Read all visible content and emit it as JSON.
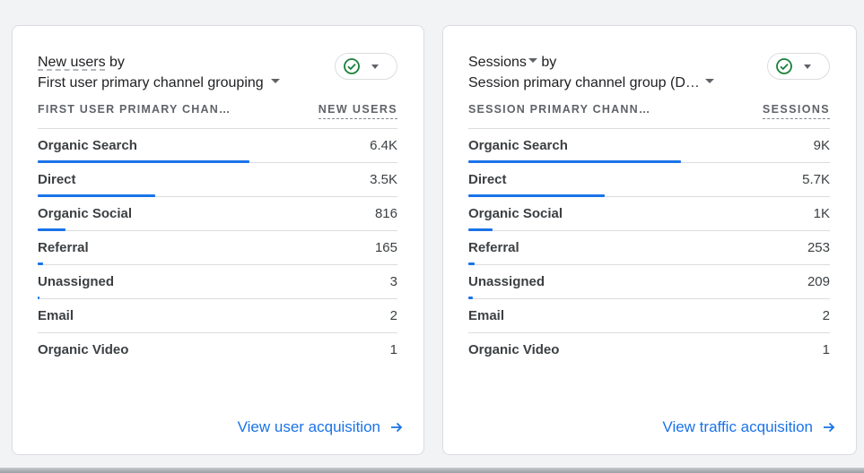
{
  "cards": [
    {
      "metric": "New users",
      "by": "by",
      "dimension": "First user primary channel grouping",
      "col_label": "FIRST USER PRIMARY CHANNEL GROUP",
      "col_value": "NEW USERS",
      "link": "View user acquisition",
      "rows": [
        {
          "label": "Organic Search",
          "value": "6.4K",
          "fraction": 1.0
        },
        {
          "label": "Direct",
          "value": "3.5K",
          "fraction": 0.555
        },
        {
          "label": "Organic Social",
          "value": "816",
          "fraction": 0.13
        },
        {
          "label": "Referral",
          "value": "165",
          "fraction": 0.026
        },
        {
          "label": "Unassigned",
          "value": "3",
          "fraction": 0.005
        },
        {
          "label": "Email",
          "value": "2",
          "fraction": 0
        },
        {
          "label": "Organic Video",
          "value": "1",
          "fraction": 0
        }
      ]
    },
    {
      "metric": "Sessions",
      "by": "by",
      "dimension": "Session primary channel group (Default Channel Group)",
      "col_label": "SESSION PRIMARY CHANNEL GROUP",
      "col_value": "SESSIONS",
      "link": "View traffic acquisition",
      "rows": [
        {
          "label": "Organic Search",
          "value": "9K",
          "fraction": 1.0
        },
        {
          "label": "Direct",
          "value": "5.7K",
          "fraction": 0.64
        },
        {
          "label": "Organic Social",
          "value": "1K",
          "fraction": 0.115
        },
        {
          "label": "Referral",
          "value": "253",
          "fraction": 0.028
        },
        {
          "label": "Unassigned",
          "value": "209",
          "fraction": 0.023
        },
        {
          "label": "Email",
          "value": "2",
          "fraction": 0
        },
        {
          "label": "Organic Video",
          "value": "1",
          "fraction": 0
        }
      ]
    }
  ],
  "colors": {
    "accent": "#1a73e8",
    "check": "#188038"
  }
}
